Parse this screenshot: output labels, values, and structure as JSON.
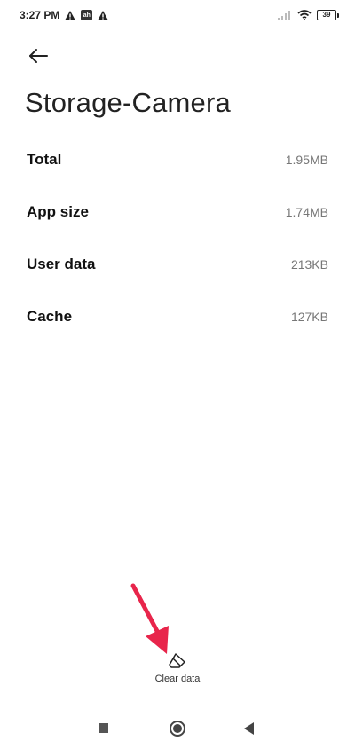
{
  "status_bar": {
    "time": "3:27 PM",
    "app_badge": "ah",
    "battery_level": "39",
    "icons": [
      "warning-icon",
      "app-notification-icon",
      "warning-icon",
      "signal-icon",
      "wifi-icon",
      "battery-icon"
    ]
  },
  "header": {
    "back_icon": "arrow-left-icon",
    "title": "Storage-Camera"
  },
  "storage": {
    "rows": [
      {
        "label": "Total",
        "value": "1.95MB"
      },
      {
        "label": "App size",
        "value": "1.74MB"
      },
      {
        "label": "User data",
        "value": "213KB"
      },
      {
        "label": "Cache",
        "value": "127KB"
      }
    ]
  },
  "actions": {
    "clear_data_label": "Clear data",
    "clear_data_icon": "eraser-icon"
  },
  "annotation": {
    "arrow_color": "#e8254b"
  },
  "nav_bar": {
    "icons": [
      "square-icon",
      "circle-icon",
      "triangle-back-icon"
    ]
  }
}
